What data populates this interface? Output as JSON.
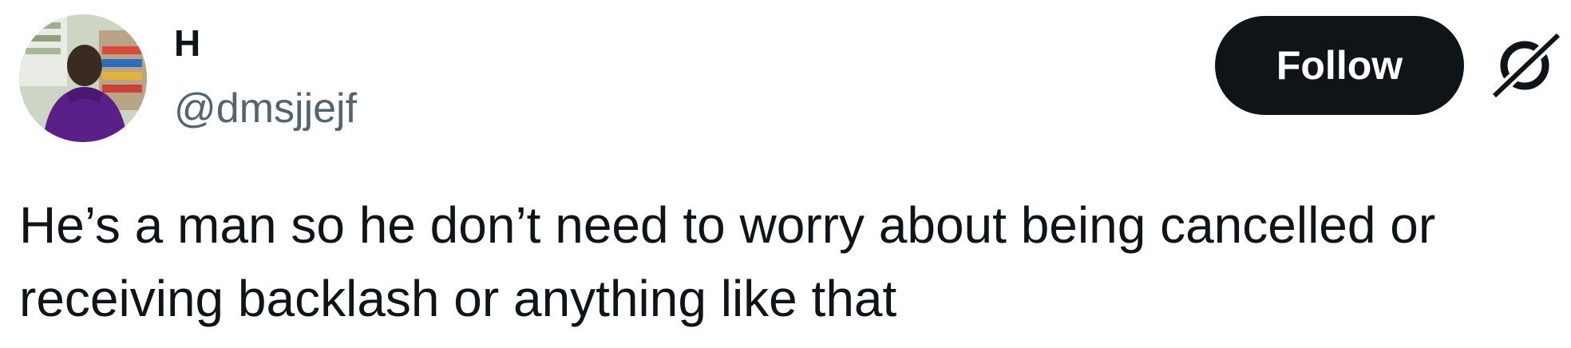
{
  "author": {
    "display_name": "H",
    "handle": "@dmsjjejf",
    "avatar_icon": "profile-photo"
  },
  "actions": {
    "follow_label": "Follow",
    "follow_bg": "#0f1419",
    "follow_fg": "#ffffff"
  },
  "brand": {
    "icon": "grok-logo-icon"
  },
  "tweet": {
    "text": "He’s a man so he don’t need to worry about being cancelled or\nreceiving backlash or anything like that"
  },
  "colors": {
    "text_primary": "#0f1419",
    "text_secondary": "#536471",
    "background": "#ffffff"
  }
}
